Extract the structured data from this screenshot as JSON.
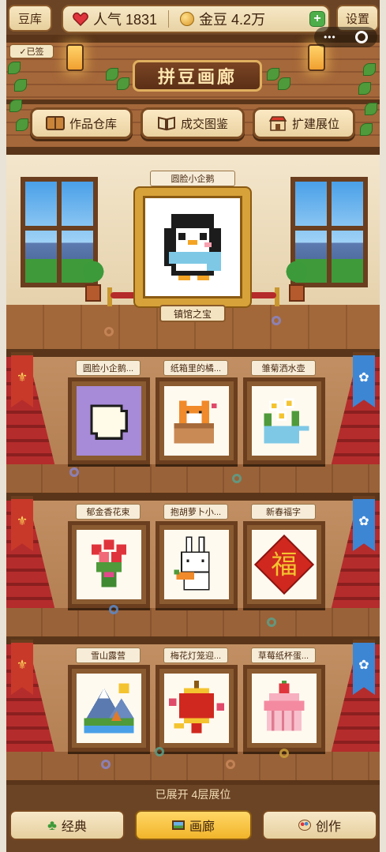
{
  "topbar": {
    "storage_label": "豆库",
    "popularity_label": "人气 1831",
    "coins_label": "金豆 4.2万",
    "add_symbol": "+",
    "settings_label": "设置",
    "menu_dots": "•••",
    "signed_label": "✓已签"
  },
  "header": {
    "title": "拼豆画廊",
    "nav": [
      {
        "label": "作品仓库",
        "icon": "book-icon"
      },
      {
        "label": "成交图鉴",
        "icon": "open-book-icon"
      },
      {
        "label": "扩建展位",
        "icon": "shop-icon"
      }
    ]
  },
  "hero": {
    "caption": "圆脸小企鹅",
    "plaque": "镇馆之宝"
  },
  "floors": [
    {
      "exhibits": [
        {
          "caption": "圆脸小企鹅...",
          "art": "penguin-outline"
        },
        {
          "caption": "纸箱里的橘...",
          "art": "cat-in-box"
        },
        {
          "caption": "雏菊洒水壶",
          "art": "daisy-watering-can"
        }
      ]
    },
    {
      "exhibits": [
        {
          "caption": "郁金香花束",
          "art": "tulip-bouquet"
        },
        {
          "caption": "抱胡萝卜小...",
          "art": "bunny-carrot"
        },
        {
          "caption": "新春福字",
          "art": "fu-character"
        }
      ]
    },
    {
      "exhibits": [
        {
          "caption": "雪山露营",
          "art": "snow-mountain-camp"
        },
        {
          "caption": "梅花灯笼迎...",
          "art": "plum-lantern"
        },
        {
          "caption": "草莓纸杯蛋...",
          "art": "strawberry-cupcake"
        }
      ]
    }
  ],
  "fu_char": "福",
  "footer": {
    "floor_count": "已展开 4层展位",
    "tabs": [
      {
        "label": "经典",
        "icon": "clover-icon"
      },
      {
        "label": "画廊",
        "icon": "picture-icon"
      },
      {
        "label": "创作",
        "icon": "palette-icon"
      }
    ]
  },
  "colors": {
    "wood_dark": "#5a3519",
    "wood": "#a5683a",
    "gold": "#d7a239",
    "carpet": "#b52c2c",
    "active_tab": "#f1b42a"
  }
}
